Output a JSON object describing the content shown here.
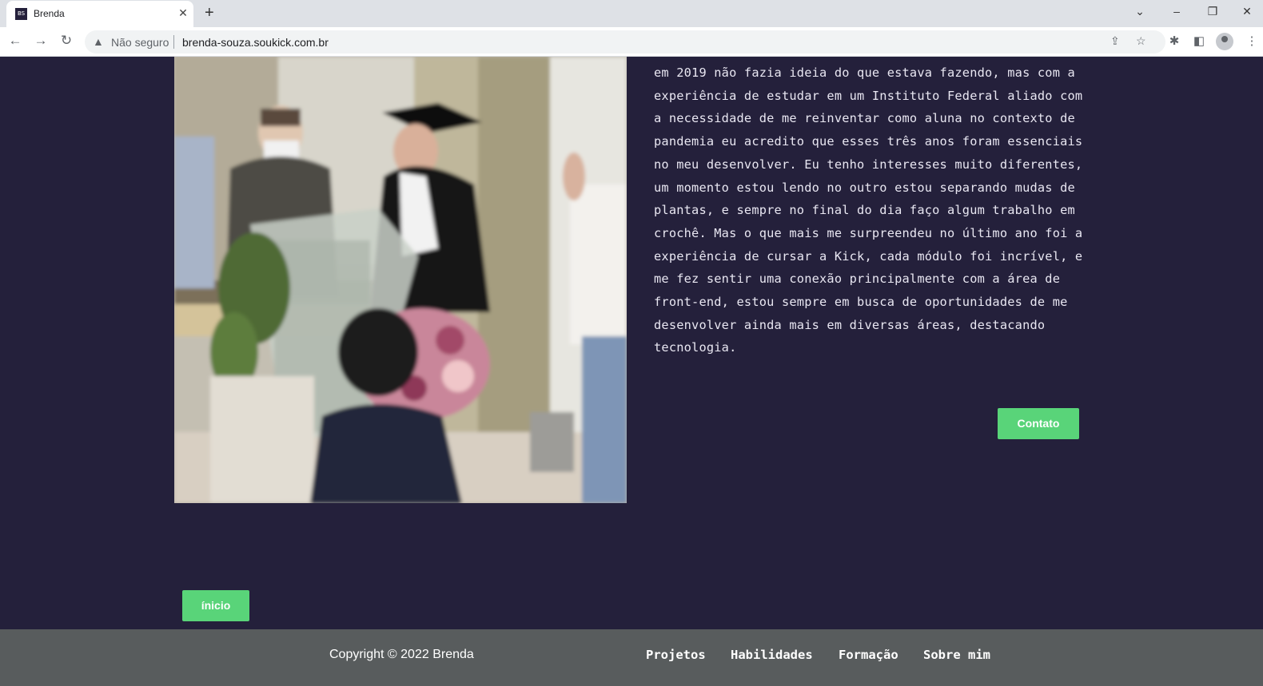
{
  "browser": {
    "tab_title": "Brenda",
    "favicon_text": "BS",
    "security_label": "Não seguro",
    "url": "brenda-souza.soukick.com.br"
  },
  "about": {
    "paragraph": "em 2019 não fazia ideia do que estava fazendo, mas com a experiência de estudar em um Instituto Federal aliado com a necessidade de me reinventar como aluna no contexto de pandemia eu acredito que esses três anos foram essenciais no meu desenvolver. Eu tenho interesses muito diferentes, um momento estou lendo no outro estou separando mudas de plantas, e sempre no final do dia faço algum trabalho em crochê. Mas o que mais me surpreendeu no último ano foi a experiência de cursar a Kick, cada módulo foi incrível, e me fez sentir uma conexão principalmente com a área de front-end,  estou sempre em busca de oportunidades de me desenvolver ainda mais em diversas áreas, destacando tecnologia.",
    "contact_button": "Contato"
  },
  "home_button": "ínicio",
  "footer": {
    "copyright": "Copyright © 2022 Brenda",
    "links": [
      "Projetos",
      "Habilidades",
      "Formação",
      "Sobre mim"
    ]
  },
  "colors": {
    "page_bg": "#24203b",
    "accent_green": "#59d479",
    "footer_bg": "#585c5d"
  }
}
